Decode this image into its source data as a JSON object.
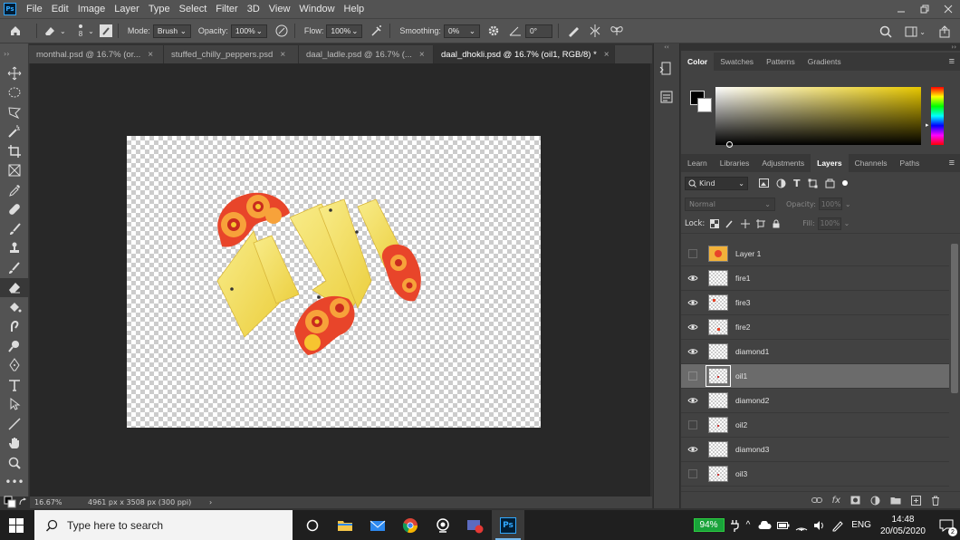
{
  "app": {
    "logo_text": "Ps"
  },
  "menu": [
    "File",
    "Edit",
    "Image",
    "Layer",
    "Type",
    "Select",
    "Filter",
    "3D",
    "View",
    "Window",
    "Help"
  ],
  "options_bar": {
    "brush_size": "8",
    "mode_label": "Mode:",
    "mode_value": "Brush",
    "opacity_label": "Opacity:",
    "opacity_value": "100%",
    "flow_label": "Flow:",
    "flow_value": "100%",
    "smoothing_label": "Smoothing:",
    "smoothing_value": "0%",
    "angle_value": "0°"
  },
  "tabs": [
    {
      "label": "monthal.psd @ 16.7% (or...",
      "active": false
    },
    {
      "label": "stuffed_chilly_peppers.psd",
      "active": false
    },
    {
      "label": "daal_ladle.psd @ 16.7% (...",
      "active": false
    },
    {
      "label": "daal_dhokli.psd @ 16.7% (oil1, RGB/8) *",
      "active": true
    }
  ],
  "tab_close": "×",
  "status": {
    "zoom": "16.67%",
    "doc_info": "4961 px x 3508 px (300 ppi)",
    "arrow": "›"
  },
  "color_panel": {
    "tabs": [
      "Color",
      "Swatches",
      "Patterns",
      "Gradients"
    ],
    "active": "Color"
  },
  "layers_panel": {
    "tabs": [
      "Learn",
      "Libraries",
      "Adjustments",
      "Layers",
      "Channels",
      "Paths"
    ],
    "active": "Layers",
    "filter_label": "Kind",
    "blend_mode": "Normal",
    "opacity_label": "Opacity:",
    "opacity_value": "100%",
    "lock_label": "Lock:",
    "fill_label": "Fill:",
    "fill_value": "100%",
    "layers": [
      {
        "name": "Layer 1",
        "visible": false,
        "selected": false
      },
      {
        "name": "fire1",
        "visible": true,
        "selected": false
      },
      {
        "name": "fire3",
        "visible": true,
        "selected": false
      },
      {
        "name": "fire2",
        "visible": true,
        "selected": false
      },
      {
        "name": "diamond1",
        "visible": true,
        "selected": false
      },
      {
        "name": "oil1",
        "visible": false,
        "selected": true
      },
      {
        "name": "diamond2",
        "visible": true,
        "selected": false
      },
      {
        "name": "oil2",
        "visible": false,
        "selected": false
      },
      {
        "name": "diamond3",
        "visible": true,
        "selected": false
      },
      {
        "name": "oil3",
        "visible": false,
        "selected": false
      }
    ],
    "footer_fx": "fx"
  },
  "taskbar": {
    "search_placeholder": "Type here to search",
    "battery": "94%",
    "language": "ENG",
    "time": "14:48",
    "date": "20/05/2020",
    "notifications": "2",
    "ps_label": "Ps"
  },
  "colors": {
    "accent": "#31a8ff",
    "fire_outer": "#e8452a",
    "fire_inner": "#f7c430",
    "diamond": "#f5e06a"
  }
}
